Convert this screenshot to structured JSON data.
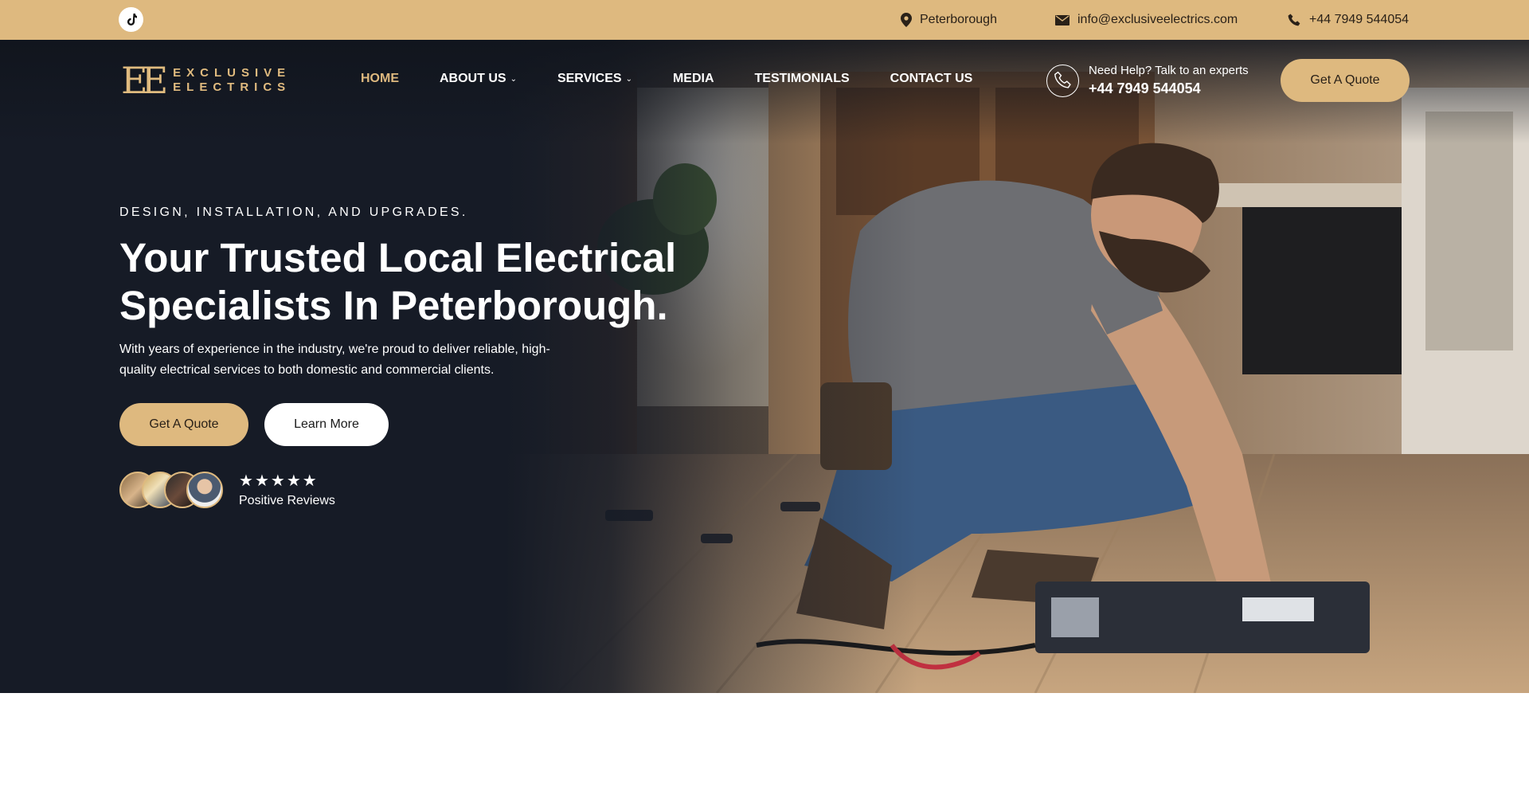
{
  "topbar": {
    "location": "Peterborough",
    "email": "info@exclusiveelectrics.com",
    "phone": "+44 7949 544054"
  },
  "logo": {
    "mark": "EE",
    "line1": "EXCLUSIVE",
    "line2": "ELECTRICS"
  },
  "nav": {
    "items": [
      {
        "label": "HOME",
        "active": true
      },
      {
        "label": "ABOUT US",
        "dropdown": true
      },
      {
        "label": "SERVICES",
        "dropdown": true
      },
      {
        "label": "MEDIA"
      },
      {
        "label": "TESTIMONIALS"
      },
      {
        "label": "CONTACT US"
      }
    ],
    "help_text": "Need Help? Talk to an experts",
    "help_phone": "+44 7949 544054",
    "quote_label": "Get A Quote"
  },
  "hero": {
    "eyebrow": "DESIGN, INSTALLATION, AND UPGRADES.",
    "headline_line1": "Your Trusted Local Electrical",
    "headline_line2": "Specialists In Peterborough.",
    "lead": "With years of experience in the industry, we're proud to deliver reliable, high-quality electrical services to both domestic and commercial clients.",
    "quote_label": "Get A Quote",
    "learn_label": "Learn More",
    "rating_stars": 5,
    "reviews_label": "Positive Reviews"
  },
  "colors": {
    "gold": "#deb97f",
    "dark": "#161b26"
  },
  "icons": [
    "tiktok-icon",
    "location-pin-icon",
    "mail-icon",
    "phone-icon",
    "phone-circle-icon",
    "chevron-down-icon",
    "star-icon"
  ]
}
